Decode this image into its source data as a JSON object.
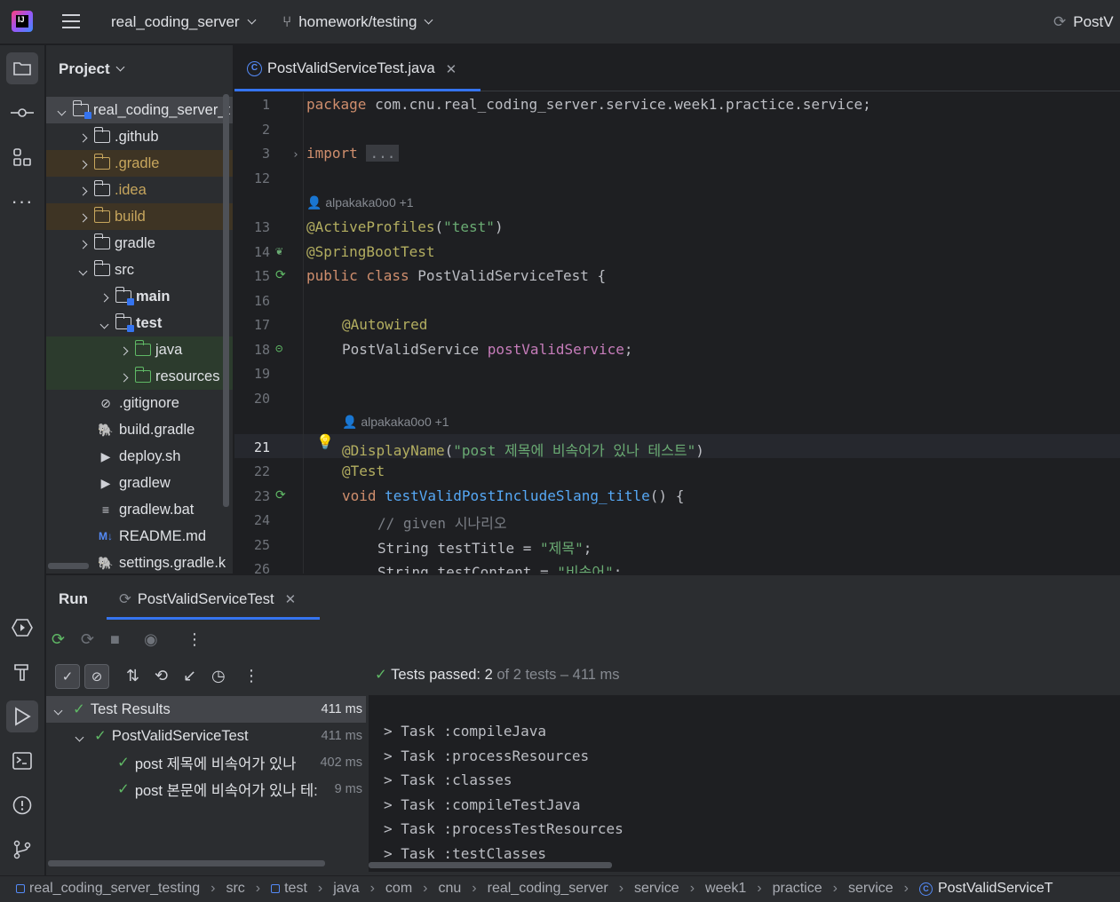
{
  "titlebar": {
    "project_name": "real_coding_server",
    "branch": "homework/testing",
    "run_config": "PostV"
  },
  "project_panel": {
    "title": "Project",
    "items": [
      {
        "label": "real_coding_server_t",
        "type": "module",
        "level": 0,
        "expanded": true
      },
      {
        "label": ".github",
        "type": "folder",
        "level": 1
      },
      {
        "label": ".gradle",
        "type": "folder-excluded",
        "level": 1
      },
      {
        "label": ".idea",
        "type": "folder-excluded",
        "level": 1
      },
      {
        "label": "build",
        "type": "folder-excluded",
        "level": 1
      },
      {
        "label": "gradle",
        "type": "folder",
        "level": 1
      },
      {
        "label": "src",
        "type": "folder",
        "level": 1,
        "expanded": true
      },
      {
        "label": "main",
        "type": "module",
        "level": 2
      },
      {
        "label": "test",
        "type": "module",
        "level": 2,
        "expanded": true
      },
      {
        "label": "java",
        "type": "test-folder",
        "level": 3
      },
      {
        "label": "resources",
        "type": "test-resources",
        "level": 3
      },
      {
        "label": ".gitignore",
        "type": "ignore-file",
        "level": 1
      },
      {
        "label": "build.gradle",
        "type": "gradle-file",
        "level": 1
      },
      {
        "label": "deploy.sh",
        "type": "shell-file",
        "level": 1
      },
      {
        "label": "gradlew",
        "type": "shell-file",
        "level": 1
      },
      {
        "label": "gradlew.bat",
        "type": "text-file",
        "level": 1
      },
      {
        "label": "README.md",
        "type": "markdown-file",
        "level": 1
      },
      {
        "label": "settings.gradle.k",
        "type": "gradle-file",
        "level": 1
      }
    ]
  },
  "editor": {
    "tab_label": "PostValidServiceTest.java",
    "author_1": "alpakaka0o0 +1",
    "author_2": "alpakaka0o0 +1",
    "line_numbers": [
      "1",
      "2",
      "3",
      "12",
      "13",
      "14",
      "15",
      "16",
      "17",
      "18",
      "19",
      "20",
      "21",
      "22",
      "23",
      "24",
      "25",
      "26"
    ],
    "code": {
      "l1_kw": "package",
      "l1_rest": " com.cnu.real_coding_server.service.week1.practice.service;",
      "l3_kw": "import",
      "l3_fold": "...",
      "l13_ann": "@ActiveProfiles",
      "l13_p1": "(",
      "l13_str": "\"test\"",
      "l13_p2": ")",
      "l14_ann": "@SpringBootTest",
      "l15_kw": "public class",
      "l15_rest": " PostValidServiceTest {",
      "l17_ann": "@Autowired",
      "l18_type": "PostValidService ",
      "l18_fld": "postValidService",
      "l18_end": ";",
      "l21_ann": "@DisplayName",
      "l21_p1": "(",
      "l21_str": "\"post 제목에 비속어가 있나 테스트\"",
      "l21_p2": ")",
      "l22_ann": "@Test",
      "l23_kw": "void ",
      "l23_fn": "testValidPostIncludeSlang_title",
      "l23_rest": "() {",
      "l24_cmt": "// given 시나리오",
      "l25_a": "String testTitle = ",
      "l25_str": "\"제목\"",
      "l25_b": ";",
      "l26_a": "String testContent = ",
      "l26_str": "\"비속어\"",
      "l26_b": ";"
    }
  },
  "run_panel": {
    "title": "Run",
    "tab_label": "PostValidServiceTest",
    "status_prefix": "Tests passed: 2",
    "status_suffix": " of 2 tests – 411 ms",
    "tests": [
      {
        "label": "Test Results",
        "duration": "411 ms"
      },
      {
        "label": "PostValidServiceTest",
        "duration": "411 ms"
      },
      {
        "label": "post 제목에 비속어가 있나",
        "duration": "402 ms"
      },
      {
        "label": "post 본문에 비속어가 있나 테:",
        "duration": "9 ms"
      }
    ],
    "console": [
      "> Task :compileJava",
      "> Task :processResources",
      "> Task :classes",
      "> Task :compileTestJava",
      "> Task :processTestResources",
      "> Task :testClasses"
    ]
  },
  "breadcrumb": [
    "real_coding_server_testing",
    "src",
    "test",
    "java",
    "com",
    "cnu",
    "real_coding_server",
    "service",
    "week1",
    "practice",
    "service",
    "PostValidServiceT"
  ],
  "colors": {
    "accent": "#3574f0",
    "success": "#5fb865",
    "keyword": "#cf8e6d",
    "annotation": "#b3ae60",
    "string": "#6aab73"
  }
}
